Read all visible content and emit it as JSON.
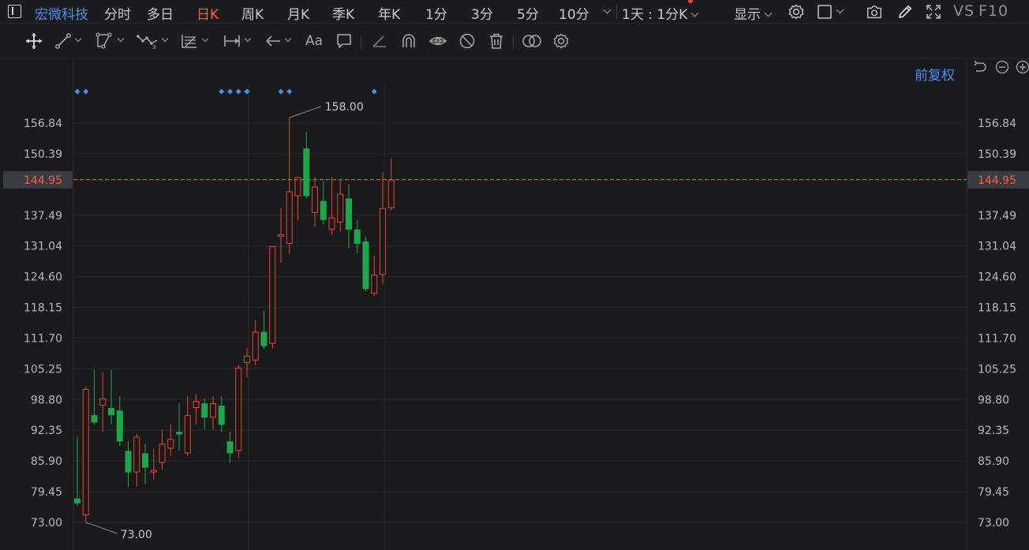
{
  "header": {
    "stock_name": "宏微科技",
    "tabs": [
      {
        "label": "分时"
      },
      {
        "label": "多日"
      },
      {
        "label": "日K",
        "active": true
      },
      {
        "label": "周K"
      },
      {
        "label": "月K"
      },
      {
        "label": "季K"
      },
      {
        "label": "年K"
      },
      {
        "label": "1分"
      },
      {
        "label": "3分"
      },
      {
        "label": "5分"
      },
      {
        "label": "10分"
      }
    ],
    "period_select": "1天 : 1分K",
    "display_label": "显示",
    "vs_label": "VS",
    "f10_label": "F10",
    "icons": [
      "settings-icon",
      "layout-icon",
      "camera-icon",
      "pen-icon",
      "fullscreen-icon"
    ]
  },
  "toolbar": {
    "font_tool_label": "Aa",
    "tools": [
      "move-icon",
      "line-icon",
      "polyline-icon",
      "wave-icon",
      "fib-icon",
      "range-icon",
      "arrow-icon",
      "font-icon",
      "comment-icon",
      "angle-icon",
      "magnet-icon",
      "eye-icon",
      "hide-icon",
      "trash-icon",
      "compare-icon",
      "gear-icon"
    ]
  },
  "chart_controls": {
    "adjust_label": "前复权",
    "icons": [
      "undo-icon",
      "zoom-out-icon",
      "zoom-in-icon"
    ]
  },
  "colors": {
    "up": "#e8452c",
    "down": "#1ea64b",
    "accent": "#4a8fe7",
    "price_line": "#ff5a3c"
  },
  "chart_data": {
    "type": "candlestick",
    "y_ticks": [
      "156.84",
      "150.39",
      "144.95",
      "137.49",
      "131.04",
      "124.60",
      "118.15",
      "111.70",
      "105.25",
      "98.80",
      "92.35",
      "85.90",
      "79.45",
      "73.00"
    ],
    "ylim": [
      73.0,
      163.0
    ],
    "current_price": "144.95",
    "high_annotation": "158.00",
    "low_annotation": "73.00",
    "candles": [
      {
        "o": 78.0,
        "h": 91.0,
        "l": 76.5,
        "c": 77.0
      },
      {
        "o": 74.5,
        "h": 101.5,
        "l": 73.0,
        "c": 101.0
      },
      {
        "o": 95.5,
        "h": 105.0,
        "l": 93.5,
        "c": 94.0
      },
      {
        "o": 97.5,
        "h": 104.5,
        "l": 92.0,
        "c": 99.0
      },
      {
        "o": 97.0,
        "h": 105.0,
        "l": 93.5,
        "c": 95.5
      },
      {
        "o": 96.5,
        "h": 99.5,
        "l": 89.0,
        "c": 90.0
      },
      {
        "o": 88.0,
        "h": 90.0,
        "l": 80.5,
        "c": 83.5
      },
      {
        "o": 83.5,
        "h": 91.5,
        "l": 80.5,
        "c": 91.0
      },
      {
        "o": 87.5,
        "h": 89.5,
        "l": 81.0,
        "c": 84.5
      },
      {
        "o": 83.5,
        "h": 88.5,
        "l": 82.0,
        "c": 84.0
      },
      {
        "o": 85.5,
        "h": 92.5,
        "l": 84.0,
        "c": 89.5
      },
      {
        "o": 88.5,
        "h": 93.5,
        "l": 87.0,
        "c": 90.5
      },
      {
        "o": 92.0,
        "h": 98.0,
        "l": 88.0,
        "c": 91.5
      },
      {
        "o": 87.5,
        "h": 99.5,
        "l": 87.0,
        "c": 95.5
      },
      {
        "o": 97.0,
        "h": 100.0,
        "l": 93.5,
        "c": 98.5
      },
      {
        "o": 98.0,
        "h": 99.0,
        "l": 92.5,
        "c": 95.0
      },
      {
        "o": 95.0,
        "h": 99.5,
        "l": 92.5,
        "c": 98.0
      },
      {
        "o": 97.5,
        "h": 99.5,
        "l": 92.0,
        "c": 93.5
      },
      {
        "o": 90.0,
        "h": 92.0,
        "l": 85.5,
        "c": 87.5
      },
      {
        "o": 88.0,
        "h": 106.0,
        "l": 86.5,
        "c": 105.5
      },
      {
        "o": 106.5,
        "h": 109.5,
        "l": 103.5,
        "c": 108.0
      },
      {
        "o": 107.0,
        "h": 115.5,
        "l": 106.0,
        "c": 113.0
      },
      {
        "o": 113.0,
        "h": 117.5,
        "l": 109.5,
        "c": 110.0
      },
      {
        "o": 110.5,
        "h": 131.0,
        "l": 109.5,
        "c": 131.0
      },
      {
        "o": 133.0,
        "h": 139.0,
        "l": 127.5,
        "c": 133.5
      },
      {
        "o": 131.5,
        "h": 158.0,
        "l": 129.5,
        "c": 142.5
      },
      {
        "o": 141.5,
        "h": 145.5,
        "l": 136.5,
        "c": 145.5
      },
      {
        "o": 151.5,
        "h": 155.0,
        "l": 141.0,
        "c": 141.5
      },
      {
        "o": 138.0,
        "h": 145.5,
        "l": 135.0,
        "c": 143.5
      },
      {
        "o": 140.5,
        "h": 144.5,
        "l": 135.5,
        "c": 136.5
      },
      {
        "o": 134.5,
        "h": 145.5,
        "l": 133.5,
        "c": 137.0
      },
      {
        "o": 136.0,
        "h": 145.0,
        "l": 134.0,
        "c": 142.0
      },
      {
        "o": 141.0,
        "h": 144.0,
        "l": 130.5,
        "c": 134.5
      },
      {
        "o": 134.5,
        "h": 136.5,
        "l": 129.5,
        "c": 131.5
      },
      {
        "o": 132.0,
        "h": 133.0,
        "l": 121.5,
        "c": 122.0
      },
      {
        "o": 121.0,
        "h": 129.0,
        "l": 120.5,
        "c": 125.0
      },
      {
        "o": 125.0,
        "h": 146.5,
        "l": 123.0,
        "c": 139.0
      },
      {
        "o": 139.0,
        "h": 149.5,
        "l": 138.5,
        "c": 144.95
      }
    ],
    "event_marker_indices": [
      0,
      1,
      17,
      18,
      19,
      20,
      24,
      25,
      35
    ],
    "vertical_guide_indices": [
      20,
      36
    ]
  }
}
